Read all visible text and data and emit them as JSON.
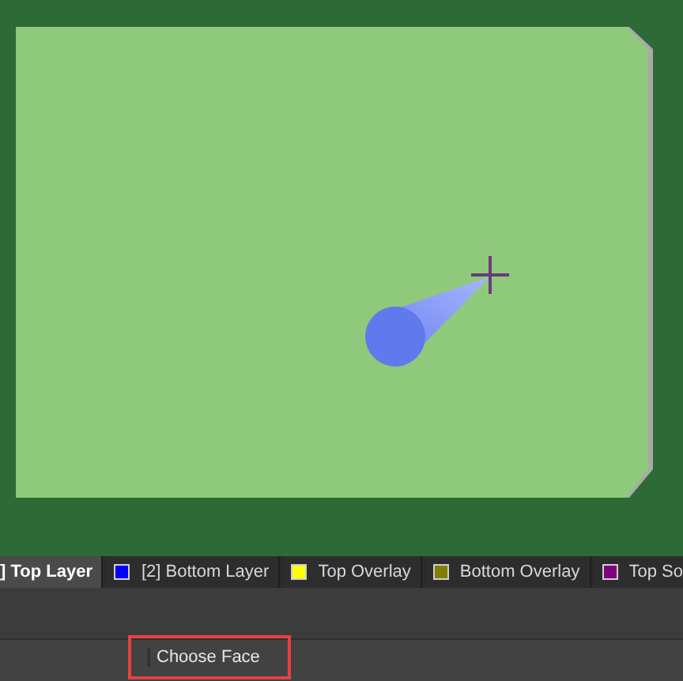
{
  "layer_tabs": [
    {
      "label": "] Top Layer",
      "selected": true
    },
    {
      "label": "[2] Bottom Layer",
      "color": "#0000ff",
      "selected": false
    },
    {
      "label": "Top Overlay",
      "color": "#ffff00",
      "selected": false
    },
    {
      "label": "Bottom Overlay",
      "color": "#808000",
      "selected": false
    },
    {
      "label": "Top So",
      "color": "#800080",
      "selected": false
    }
  ],
  "status_bar": {
    "prompt": "Choose Face"
  }
}
